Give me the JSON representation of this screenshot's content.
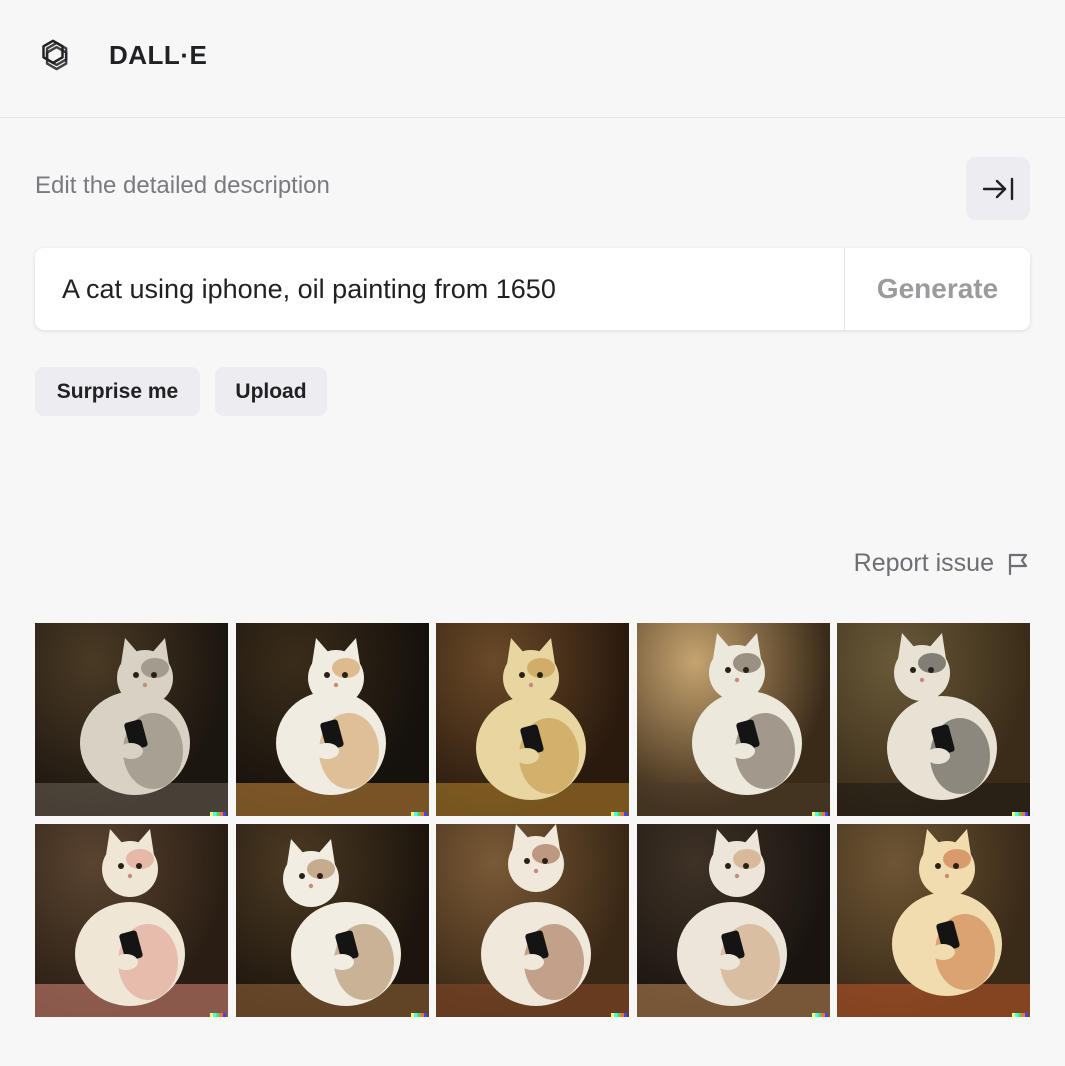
{
  "header": {
    "logo_icon": "openai-logo-icon",
    "title": "DALL·E"
  },
  "editor": {
    "label": "Edit the detailed description",
    "collapse_icon": "arrow-right-to-bar-icon",
    "prompt_value": "A cat using iphone, oil painting from 1650",
    "generate_label": "Generate",
    "surprise_label": "Surprise me",
    "upload_label": "Upload"
  },
  "results": {
    "report_label": "Report issue",
    "report_icon": "flag-icon",
    "images": [
      {
        "name": "result-image-1",
        "bg1": "#1c1610",
        "bg2": "#4a3a24",
        "fur": "#d8d2c4",
        "accent": "#6b6558"
      },
      {
        "name": "result-image-2",
        "bg1": "#15110c",
        "bg2": "#3a2c1a",
        "fur": "#f0ece2",
        "accent": "#c98a3c"
      },
      {
        "name": "result-image-3",
        "bg1": "#2a1a0e",
        "bg2": "#6a4a28",
        "fur": "#e8d6a0",
        "accent": "#b8862e"
      },
      {
        "name": "result-image-4",
        "bg1": "#3a2a18",
        "bg2": "#c6a470",
        "fur": "#ece8dc",
        "accent": "#4a3a2a"
      },
      {
        "name": "result-image-5",
        "bg1": "#3a2c18",
        "bg2": "#6a5a3a",
        "fur": "#e8e2d4",
        "accent": "#1e1a16"
      },
      {
        "name": "result-image-6",
        "bg1": "#2a1e14",
        "bg2": "#5a4430",
        "fur": "#f0e6d6",
        "accent": "#d98a7a"
      },
      {
        "name": "result-image-7",
        "bg1": "#1c150e",
        "bg2": "#4c3a22",
        "fur": "#f2ede2",
        "accent": "#9a6a3a"
      },
      {
        "name": "result-image-8",
        "bg1": "#3a2816",
        "bg2": "#7a5a36",
        "fur": "#f0e8da",
        "accent": "#8a4a28"
      },
      {
        "name": "result-image-9",
        "bg1": "#1a1410",
        "bg2": "#3e3226",
        "fur": "#ece6da",
        "accent": "#c48e5a"
      },
      {
        "name": "result-image-10",
        "bg1": "#3a2a18",
        "bg2": "#6e5634",
        "fur": "#f0dcae",
        "accent": "#c25a2a"
      }
    ]
  }
}
